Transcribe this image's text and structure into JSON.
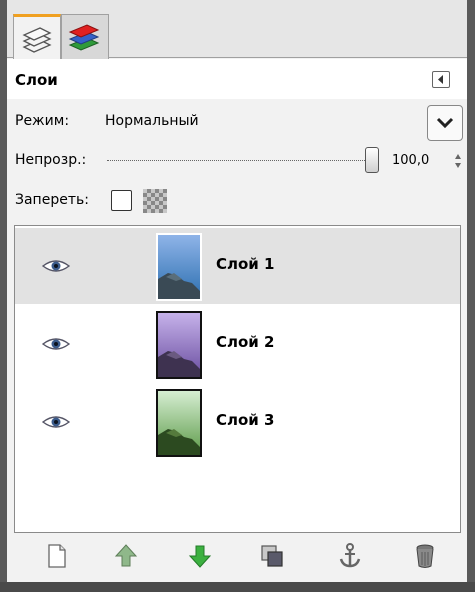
{
  "dialog": {
    "title": "Слои"
  },
  "mode": {
    "label": "Режим:",
    "value": "Нормальный"
  },
  "opacity": {
    "label": "Непрозр.:",
    "value": "100,0",
    "level": 1.0
  },
  "lock": {
    "label": "Запереть:"
  },
  "layers": [
    {
      "name": "Слой 1",
      "visible": true,
      "selected": true
    },
    {
      "name": "Слой 2",
      "visible": true,
      "selected": false
    },
    {
      "name": "Слой 3",
      "visible": true,
      "selected": false
    }
  ],
  "toolbar": {
    "icons": [
      "new-layer-icon",
      "raise-layer-icon",
      "lower-layer-icon",
      "duplicate-layer-icon",
      "anchor-layer-icon",
      "delete-layer-icon"
    ]
  },
  "tabs": {
    "icons": [
      "layers-tab-icon",
      "channels-tab-icon"
    ]
  },
  "colors": {
    "tab_accent": "#f0a020",
    "selected_row": "#e2e2e2",
    "arrow_green": "#3cb040"
  }
}
